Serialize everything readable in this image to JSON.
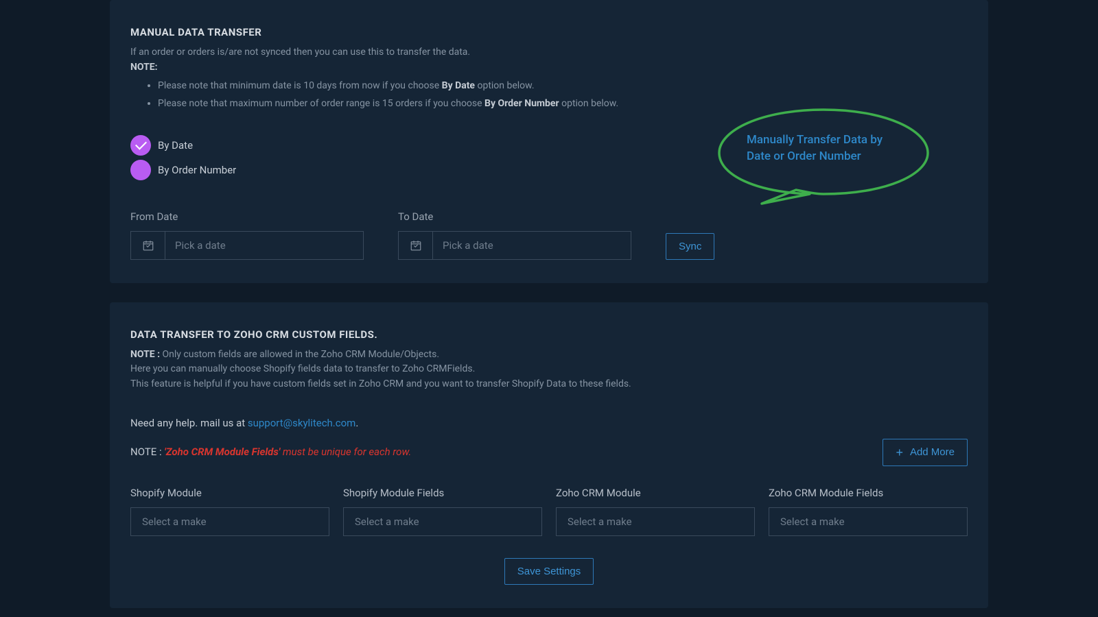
{
  "panel1": {
    "title": "MANUAL DATA TRANSFER",
    "desc": "If an order or orders is/are not synced then you can use this to transfer the data.",
    "note_label": "NOTE:",
    "bullet1_pre": "Please note that minimum date is 10 days from now if you choose ",
    "bullet1_bold": "By Date",
    "bullet1_post": " option below.",
    "bullet2_pre": "Please note that maximum number of order range is 15 orders if you choose ",
    "bullet2_bold": "By Order Number",
    "bullet2_post": " option below.",
    "radio1": "By Date",
    "radio2": "By Order Number",
    "from_label": "From Date",
    "to_label": "To Date",
    "date_placeholder": "Pick a date",
    "sync": "Sync",
    "callout": "Manually Transfer Data by Date or Order Number"
  },
  "panel2": {
    "title": "DATA TRANSFER TO ZOHO CRM CUSTOM FIELDS.",
    "note_label": "NOTE : ",
    "note_text": "Only custom fields are allowed in the Zoho CRM Module/Objects.",
    "line2": "Here you can manually choose Shopify fields data to transfer to Zoho CRMFields.",
    "line3": "This feature is helpful if you have custom fields set in Zoho CRM and you want to transfer Shopify Data to these fields.",
    "help_pre": "Need any help. mail us at ",
    "help_email": "support@skylitech.com",
    "help_post": ".",
    "note2_label": "NOTE : ",
    "note2_red_bold": "'Zoho CRM Module Fields'",
    "note2_red_rest": " must be unique for each row.",
    "add_more": "Add More",
    "col1": "Shopify Module",
    "col2": "Shopify Module Fields",
    "col3": "Zoho CRM Module",
    "col4": "Zoho CRM Module Fields",
    "select_placeholder": "Select a make",
    "save": "Save Settings"
  }
}
